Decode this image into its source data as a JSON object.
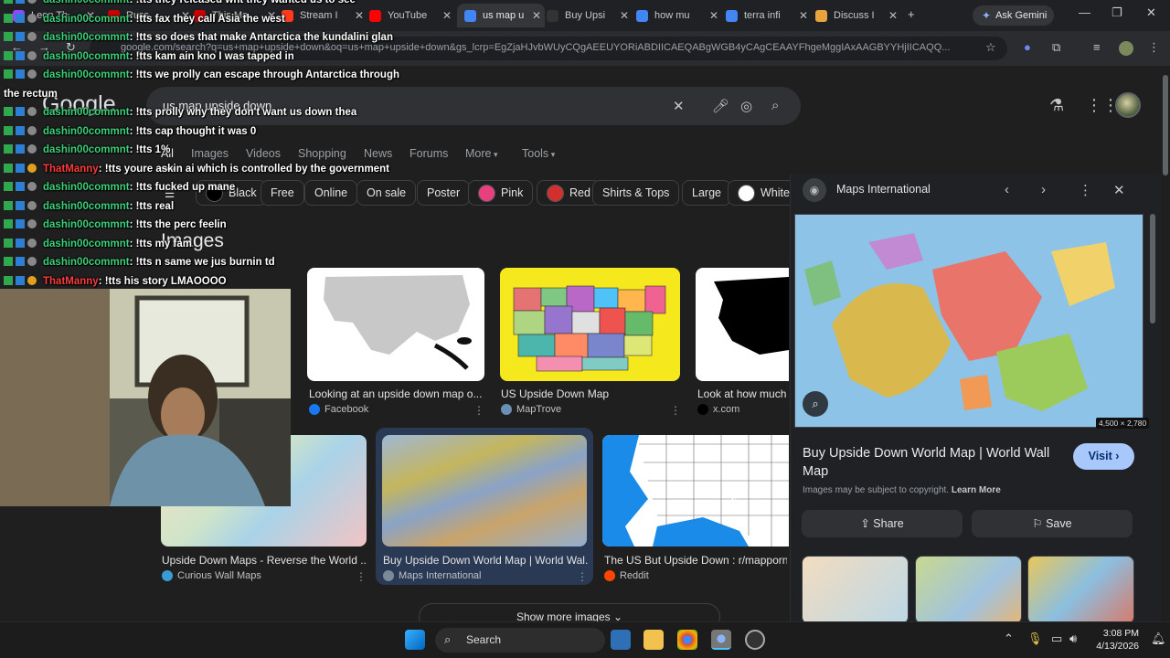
{
  "browser": {
    "tabs": [
      {
        "label": "Leon Th",
        "color": "#9146ff"
      },
      {
        "label": "Russ",
        "color": "#cc0000"
      },
      {
        "label": "This Ma",
        "color": "#cc0000"
      },
      {
        "label": "Stream I",
        "color": "#ff3a1e"
      },
      {
        "label": "YouTube",
        "color": "#ff0000"
      },
      {
        "label": "us map u",
        "color": "#4285f4"
      },
      {
        "label": "Buy Upsi",
        "color": "#333333"
      },
      {
        "label": "how mu",
        "color": "#4285f4"
      },
      {
        "label": "terra infi",
        "color": "#4285f4"
      },
      {
        "label": "Discuss I",
        "color": "#e8a33d"
      }
    ],
    "new_tab": "+",
    "ask_gemini": "Ask Gemini",
    "url": "google.com/search?q=us+map+upside+down&oq=us+map+upside+down&gs_lcrp=EgZjaHJvbWUyCQgAEEUYORiABDIICAEQABgWGB4yCAgCEAAYFhgeMggIAxAAGBYYHjIICAQQ..."
  },
  "google": {
    "logo": "Google",
    "query": "us map upside down",
    "nav_tabs": [
      "All",
      "Images",
      "Videos",
      "Shopping",
      "News",
      "Forums",
      "More",
      "Tools"
    ],
    "filter_chips": [
      {
        "label": "Black",
        "color": "#000000"
      },
      {
        "label": "Free"
      },
      {
        "label": "Online"
      },
      {
        "label": "On sale"
      },
      {
        "label": "Poster"
      },
      {
        "label": "Pink",
        "color": "#e8407f"
      },
      {
        "label": "Red",
        "color": "#d32f2f"
      },
      {
        "label": "Shirts & Tops"
      },
      {
        "label": "Large"
      },
      {
        "label": "White",
        "color": "#ffffff"
      }
    ],
    "images_heading": "Images",
    "results": [
      {
        "title": "Looking at an upside down map o...",
        "source": "Facebook",
        "src_color": "#1877f2"
      },
      {
        "title": "US Upside Down Map",
        "source": "MapTrove",
        "src_color": "#6b8fb3"
      },
      {
        "title": "Look at how much a",
        "source": "x.com",
        "src_color": "#000000"
      },
      {
        "title": "Upside Down Maps - Reverse the World ...",
        "source": "Curious Wall Maps",
        "src_color": "#3a9bd5"
      },
      {
        "title": "Buy Upside Down World Map | World Wal...",
        "source": "Maps International",
        "src_color": "#7a8a99"
      },
      {
        "title": "The US But Upside Down : r/mapporncii",
        "source": "Reddit",
        "src_color": "#ff4500"
      }
    ],
    "show_more": "Show more images"
  },
  "panel": {
    "source": "Maps International",
    "dimensions": "4,500 × 2,780",
    "title": "Buy Upside Down World Map | World Wall Map",
    "visit": "Visit",
    "copyright": "Images may be subject to copyright.",
    "learn_more": "Learn More",
    "share": "Share",
    "save": "Save"
  },
  "chat": [
    {
      "user": "dashin00commnt",
      "msg": ": !tts they released wht they wanted us to see"
    },
    {
      "user": "dashin00commnt",
      "msg": ": !tts fax they call Asia the west"
    },
    {
      "user": "dashin00commnt",
      "msg": ": !tts so does that make Antarctica the kundalini glan"
    },
    {
      "user": "dashin00commnt",
      "msg": ": !tts kam ain kno I was tapped in"
    },
    {
      "user": "dashin00commnt",
      "msg": ": !tts we prolly can escape through Antarctica through"
    },
    {
      "user": "",
      "msg": "the rectum"
    },
    {
      "user": "dashin00commnt",
      "msg": ": !tts prolly why they don't want us down thea"
    },
    {
      "user": "dashin00commnt",
      "msg": ": !tts cap thought it was 0"
    },
    {
      "user": "dashin00commnt",
      "msg": ": !tts 1%"
    },
    {
      "user": "ThatManny",
      "msg": ": !tts youre askin ai which is controlled by the government",
      "red": true
    },
    {
      "user": "dashin00commnt",
      "msg": ": !tts fucked up mane"
    },
    {
      "user": "dashin00commnt",
      "msg": ": !tts real"
    },
    {
      "user": "dashin00commnt",
      "msg": ": !tts the perc feelin"
    },
    {
      "user": "dashin00commnt",
      "msg": ": !tts my fam"
    },
    {
      "user": "dashin00commnt",
      "msg": ": !tts n same we jus burnin td"
    },
    {
      "user": "ThatManny",
      "msg": ": !tts his story LMAOOOO",
      "red": true
    }
  ],
  "taskbar": {
    "search": "Search",
    "time": "3:08 PM",
    "date": "4/13/2026"
  }
}
